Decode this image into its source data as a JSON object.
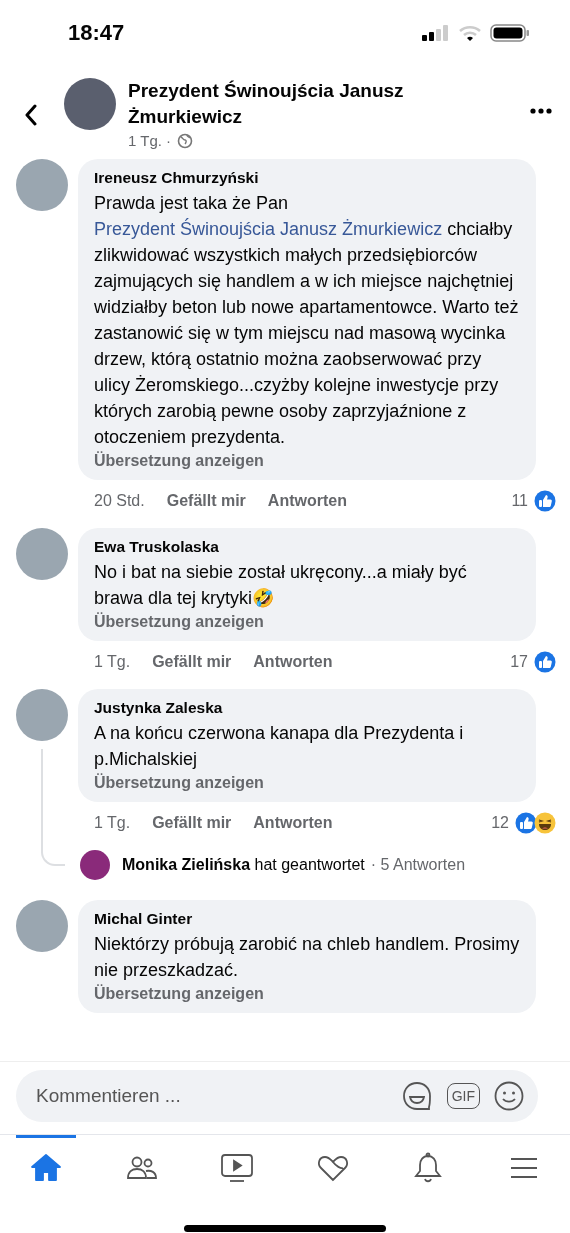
{
  "status_bar": {
    "time": "18:47"
  },
  "header": {
    "title": "Prezydent Świnoujścia Janusz Żmurkiewicz",
    "meta": "1 Tg. ·"
  },
  "comments": [
    {
      "author": "Ireneusz Chmurzyński",
      "segments": [
        {
          "kind": "plain",
          "text": "Prawda jest taka że Pan "
        },
        {
          "kind": "mention",
          "text": "Prezydent Świnoujścia Janusz Żmurkiewicz"
        },
        {
          "kind": "plain",
          "text": " chciałby zlikwidować wszystkich małych przedsiębiorców zajmujących się handlem a w ich miejsce najchętniej widziałby beton lub nowe apartamentowce. Warto też zastanowić się w tym miejscu nad masową wycinka drzew, którą ostatnio można zaobserwować przy ulicy Żeromskiego...czyżby kolejne inwestycje przy których zarobią pewne osoby zaprzyjaźnione z otoczeniem prezydenta."
        }
      ],
      "translate": "Übersetzung anzeigen",
      "time": "20 Std.",
      "like": "Gefällt mir",
      "reply": "Antworten",
      "count": "11",
      "reactions": [
        {
          "kind": "like"
        }
      ]
    },
    {
      "author": "Ewa Truskolaska",
      "segments": [
        {
          "kind": "plain",
          "text": "No i bat na siebie został ukręcony...a miały być brawa dla tej krytyki🤣"
        }
      ],
      "translate": "Übersetzung anzeigen",
      "time": "1 Tg.",
      "like": "Gefällt mir",
      "reply": "Antworten",
      "count": "17",
      "reactions": [
        {
          "kind": "like"
        }
      ]
    },
    {
      "author": "Justynka Zaleska",
      "segments": [
        {
          "kind": "plain",
          "text": "A na końcu czerwona kanapa dla Prezydenta i p.Michalskiej"
        }
      ],
      "translate": "Übersetzung anzeigen",
      "time": "1 Tg.",
      "like": "Gefällt mir",
      "reply": "Antworten",
      "count": "12",
      "reactions": [
        {
          "kind": "like"
        },
        {
          "kind": "haha"
        }
      ],
      "replies": {
        "summary": "**Monika Zielińska** hat geantwortet",
        "count": "· 5 Antworten"
      }
    },
    {
      "author": "Michal Ginter",
      "segments": [
        {
          "kind": "plain",
          "text": "Niektórzy próbują zarobić na chleb handlem. Prosimy nie przeszkadzać."
        }
      ],
      "translate": "Übersetzung anzeigen"
    }
  ],
  "composer": {
    "placeholder": "Kommentieren ...",
    "gif_label": "GIF"
  },
  "nav": [
    {
      "kind": "home",
      "selected": true
    },
    {
      "kind": "friends",
      "selected": false
    },
    {
      "kind": "watch",
      "selected": false
    },
    {
      "kind": "dating",
      "selected": false
    },
    {
      "kind": "notifications",
      "selected": false
    },
    {
      "kind": "menu",
      "selected": false
    }
  ]
}
